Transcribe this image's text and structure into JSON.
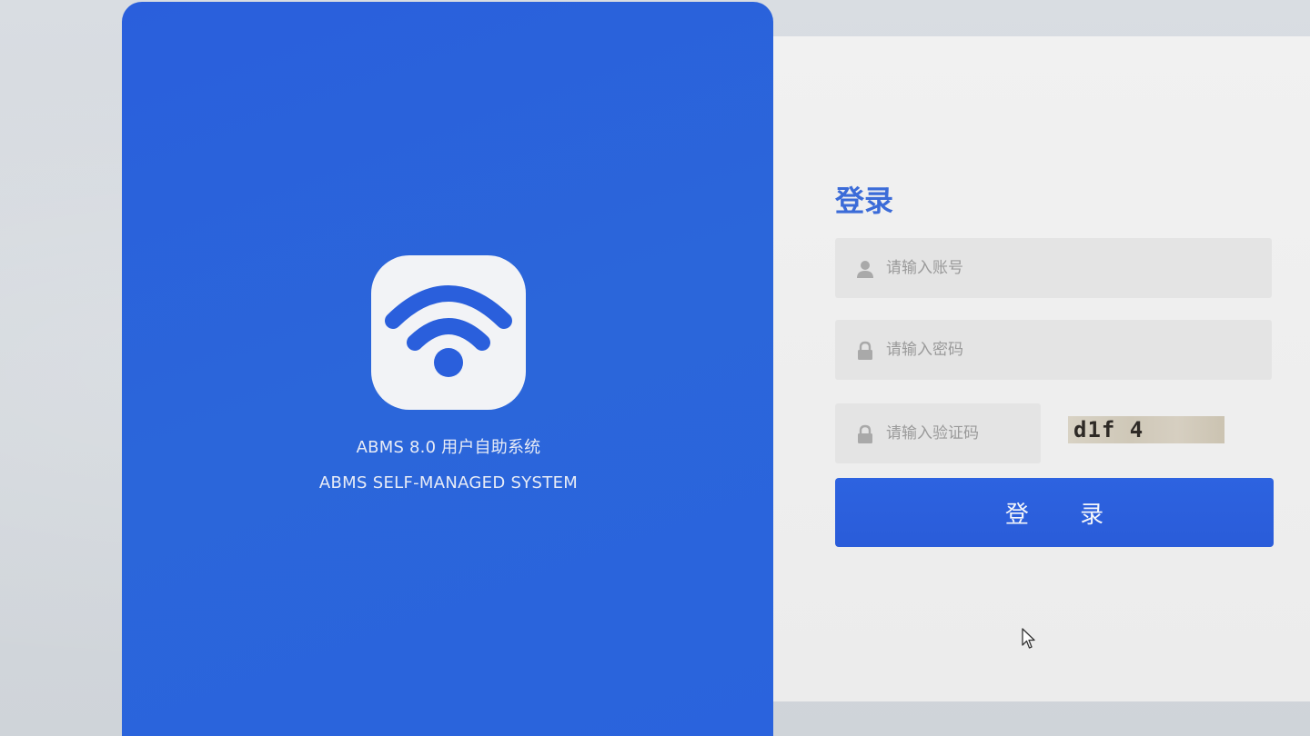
{
  "brand": {
    "title": "ABMS 8.0 用户自助系统",
    "subtitle": "ABMS SELF-MANAGED SYSTEM",
    "logo_icon": "wifi-icon",
    "color": "#2a5fdc"
  },
  "login": {
    "title": "登录",
    "username_placeholder": "请输入账号",
    "password_placeholder": "请输入密码",
    "captcha_placeholder": "请输入验证码",
    "captcha_text": "d1f 4",
    "submit_label": "登 录",
    "accent": "#3b6bd8"
  },
  "icons": {
    "user": "user-icon",
    "lock": "lock-icon",
    "cursor": "mouse-pointer-icon"
  }
}
